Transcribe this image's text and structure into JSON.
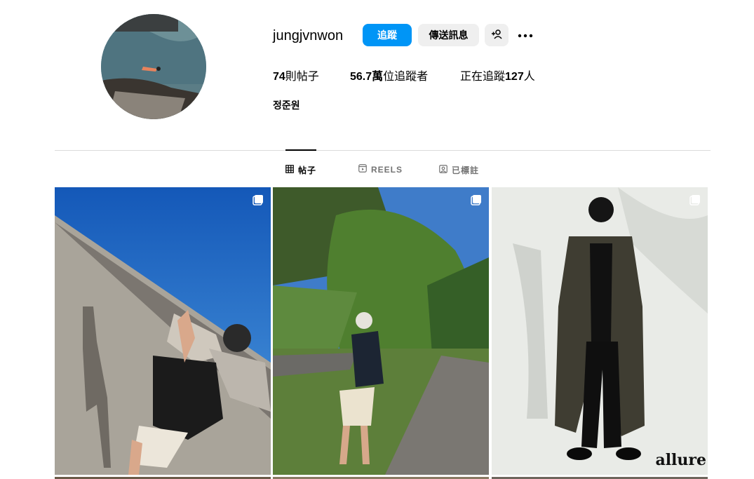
{
  "profile": {
    "username": "jungjvnwon",
    "full_name": "정준원",
    "avatar_icon": "avatar-photo-swimmer"
  },
  "actions": {
    "follow_label": "追蹤",
    "message_label": "傳送訊息",
    "add_user_icon": "add-user-icon",
    "more_icon": "more-options-icon"
  },
  "stats": {
    "posts": {
      "value": "74",
      "label": "則帖子"
    },
    "followers": {
      "value": "56.7萬",
      "label": "位追蹤者"
    },
    "following": {
      "prefix": "正在追蹤",
      "value": "127",
      "suffix": "人"
    }
  },
  "tabs": [
    {
      "label": "帖子",
      "icon": "grid-icon",
      "active": true
    },
    {
      "label": "REELS",
      "icon": "reels-icon",
      "active": false
    },
    {
      "label": "已標註",
      "icon": "tagged-icon",
      "active": false
    }
  ],
  "posts": [
    {
      "type": "carousel",
      "scene": "man waving on seawall under blue sky"
    },
    {
      "type": "carousel",
      "scene": "man standing on path under trees"
    },
    {
      "type": "carousel",
      "scene": "man in long olive coat studio shot",
      "brand_text": "allure"
    }
  ],
  "colors": {
    "accent": "#0095f6",
    "button_gray": "#efefef",
    "divider": "#dbdbdb",
    "muted_text": "#737373"
  }
}
